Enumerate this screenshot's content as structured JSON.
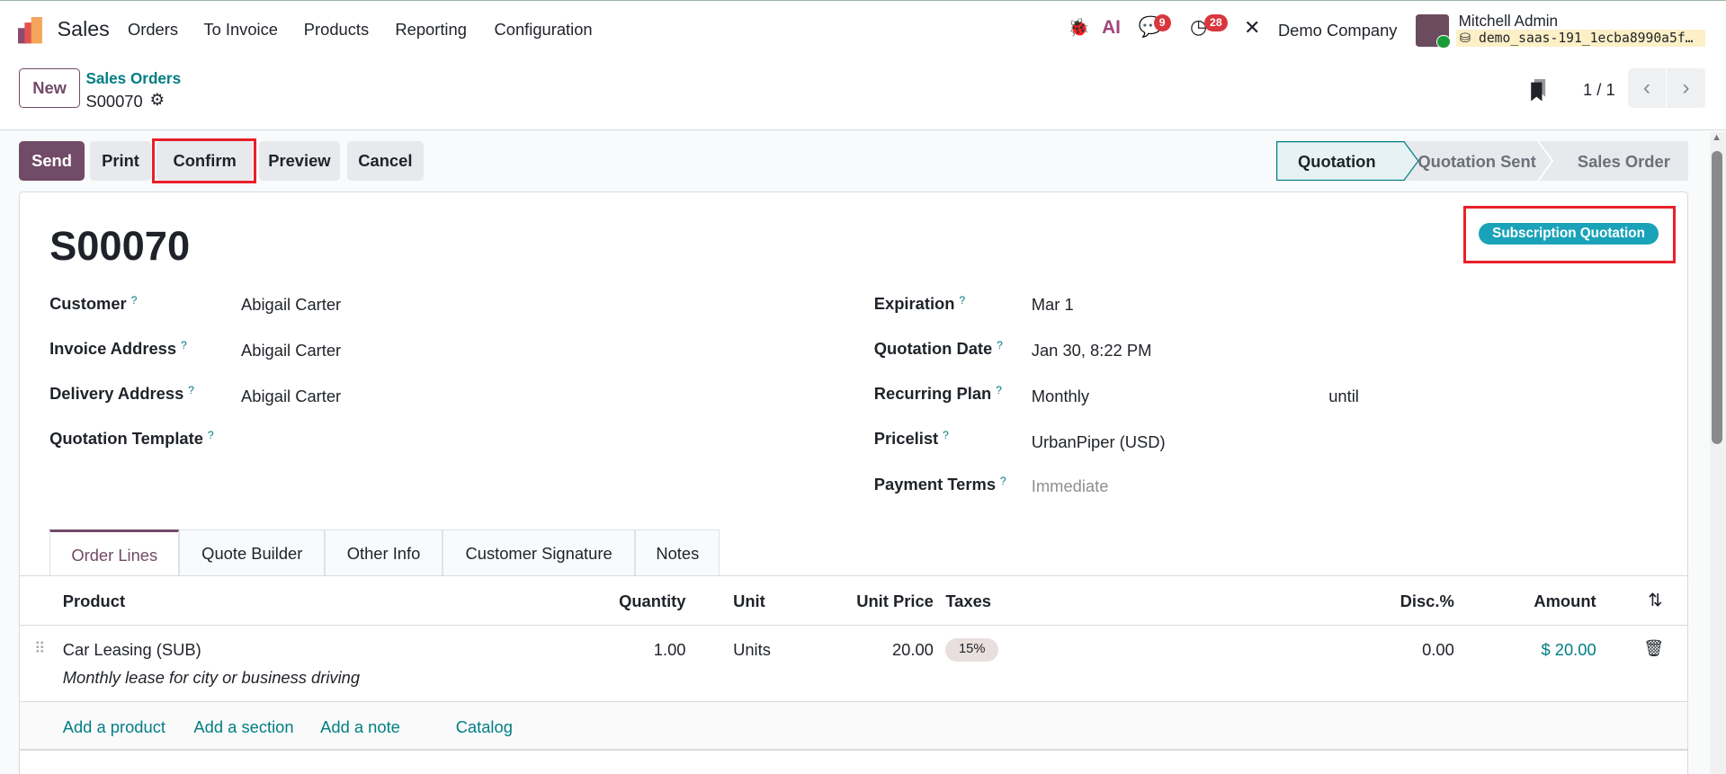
{
  "navbar": {
    "app_name": "Sales",
    "menu": [
      "Orders",
      "To Invoice",
      "Products",
      "Reporting",
      "Configuration"
    ],
    "messages_count": "9",
    "activities_count": "28",
    "company": "Demo Company",
    "user_name": "Mitchell Admin",
    "database": "demo_saas-191_1ecba8990a5f…"
  },
  "control_panel": {
    "new_label": "New",
    "breadcrumb_parent": "Sales Orders",
    "breadcrumb_current": "S00070",
    "pager": "1 / 1"
  },
  "actions": {
    "send": "Send",
    "print": "Print",
    "confirm": "Confirm",
    "preview": "Preview",
    "cancel": "Cancel"
  },
  "statusbar": {
    "stages": [
      "Quotation",
      "Quotation Sent",
      "Sales Order"
    ],
    "active": "Quotation"
  },
  "form": {
    "title": "S00070",
    "ribbon": "Subscription Quotation",
    "ribbon_color": "#1aa3b8",
    "left_fields": [
      {
        "label": "Customer",
        "value": "Abigail Carter"
      },
      {
        "label": "Invoice Address",
        "value": "Abigail Carter"
      },
      {
        "label": "Delivery Address",
        "value": "Abigail Carter"
      },
      {
        "label": "Quotation Template",
        "value": ""
      }
    ],
    "right_fields": [
      {
        "label": "Expiration",
        "value": "Mar 1"
      },
      {
        "label": "Quotation Date",
        "value": "Jan 30, 8:22 PM"
      },
      {
        "label": "Recurring Plan",
        "value": "Monthly",
        "extra": "until"
      },
      {
        "label": "Pricelist",
        "value": "UrbanPiper (USD)"
      },
      {
        "label": "Payment Terms",
        "value": "Immediate"
      }
    ],
    "help_mark": "?"
  },
  "tabs": [
    "Order Lines",
    "Quote Builder",
    "Other Info",
    "Customer Signature",
    "Notes"
  ],
  "table": {
    "headers": {
      "product": "Product",
      "quantity": "Quantity",
      "unit": "Unit",
      "unit_price": "Unit Price",
      "taxes": "Taxes",
      "discount": "Disc.%",
      "amount": "Amount"
    },
    "rows": [
      {
        "product": "Car Leasing (SUB)",
        "description": "Monthly lease for city or business driving",
        "quantity": "1.00",
        "unit": "Units",
        "unit_price": "20.00",
        "tax": "15%",
        "discount": "0.00",
        "amount": "$ 20.00"
      }
    ],
    "add_links": [
      "Add a product",
      "Add a section",
      "Add a note",
      "Catalog"
    ]
  }
}
